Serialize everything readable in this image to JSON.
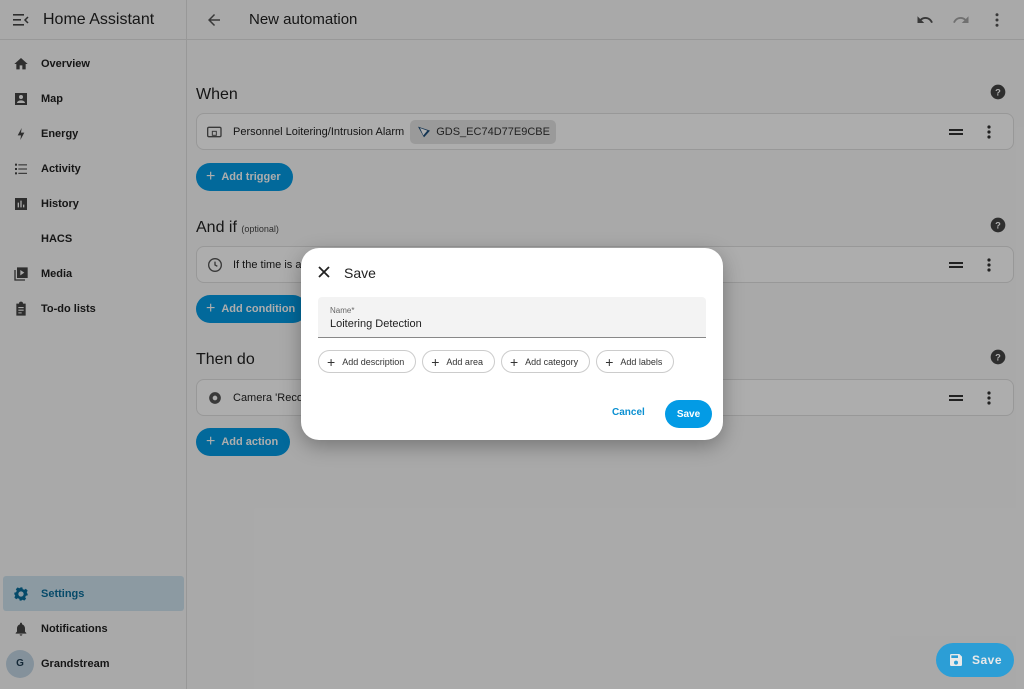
{
  "app": {
    "title": "Home Assistant"
  },
  "sidebar": {
    "items": [
      {
        "label": "Overview",
        "icon": "home-icon"
      },
      {
        "label": "Map",
        "icon": "map-icon"
      },
      {
        "label": "Energy",
        "icon": "lightning-icon"
      },
      {
        "label": "Activity",
        "icon": "list-icon"
      },
      {
        "label": "History",
        "icon": "chart-icon"
      },
      {
        "label": "HACS",
        "icon": ""
      },
      {
        "label": "Media",
        "icon": "play-icon"
      },
      {
        "label": "To-do lists",
        "icon": "clipboard-icon"
      }
    ],
    "bottom": {
      "settings": "Settings",
      "notifications": "Notifications",
      "user": "Grandstream",
      "user_initial": "G"
    }
  },
  "header": {
    "title": "New automation"
  },
  "sections": {
    "when": {
      "title": "When",
      "card_text": "Personnel Loitering/Intrusion Alarm",
      "chip": "GDS_EC74D77E9CBE",
      "button": "Add trigger"
    },
    "and_if": {
      "title": "And if",
      "optional": "(optional)",
      "card_text": "If the time is af",
      "button": "Add condition"
    },
    "then_do": {
      "title": "Then do",
      "card_text": "Camera 'Record",
      "button": "Add action"
    }
  },
  "fab": {
    "label": "Save"
  },
  "dialog": {
    "title": "Save",
    "name_label": "Name*",
    "name_value": "Loitering Detection",
    "chips": [
      "Add description",
      "Add area",
      "Add category",
      "Add labels"
    ],
    "cancel": "Cancel",
    "save": "Save"
  },
  "colors": {
    "accent": "#039be5",
    "active_bg": "#cfe4ef"
  }
}
